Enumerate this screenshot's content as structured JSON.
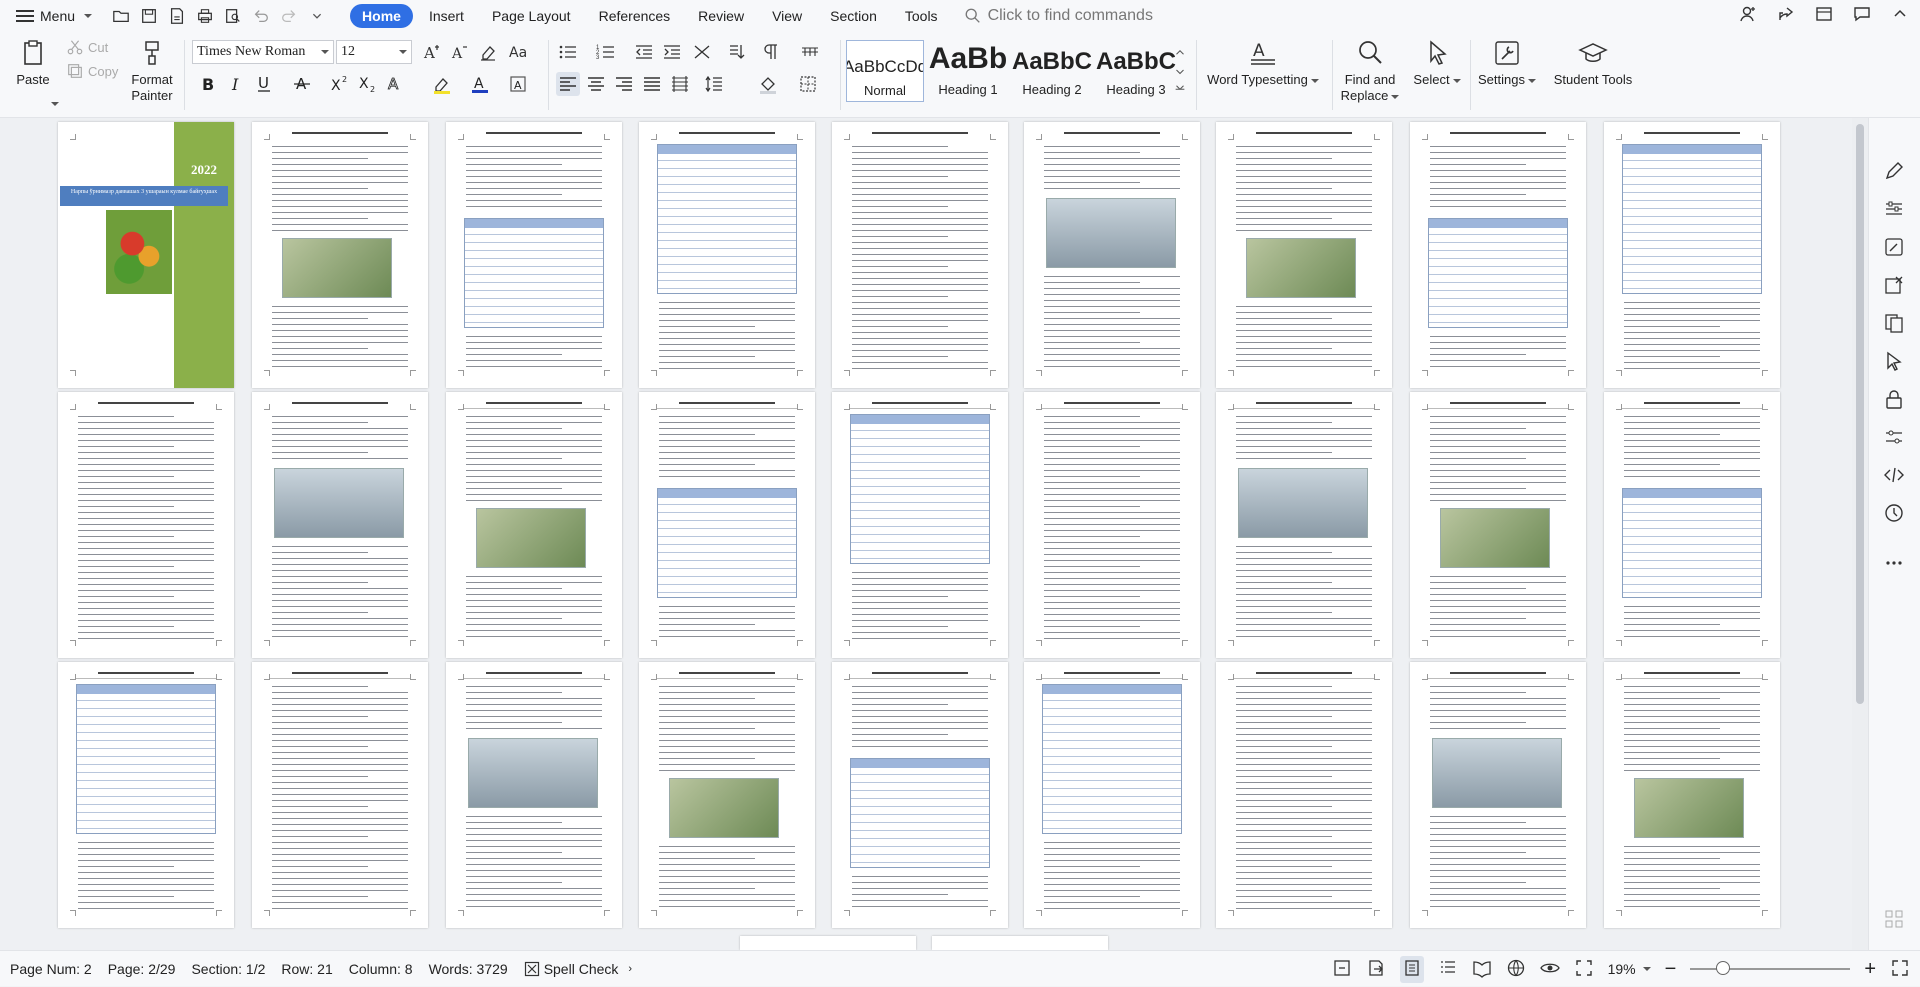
{
  "menubar": {
    "menu_label": "Menu",
    "tabs": [
      {
        "label": "Home",
        "active": true
      },
      {
        "label": "Insert"
      },
      {
        "label": "Page Layout"
      },
      {
        "label": "References"
      },
      {
        "label": "Review"
      },
      {
        "label": "View"
      },
      {
        "label": "Section"
      },
      {
        "label": "Tools"
      }
    ],
    "command_search_placeholder": "Click to find commands"
  },
  "ribbon": {
    "paste_label": "Paste",
    "cut_label": "Cut",
    "copy_label": "Copy",
    "format_painter_label_1": "Format",
    "format_painter_label_2": "Painter",
    "font_name": "Times New Roman",
    "font_size": "12",
    "styles": [
      {
        "preview": "AaBbCcDd",
        "name": "Normal",
        "selected": true
      },
      {
        "preview": "AaBb",
        "name": "Heading 1"
      },
      {
        "preview": "AaBbC",
        "name": "Heading 2"
      },
      {
        "preview": "AaBbC",
        "name": "Heading 3"
      }
    ],
    "word_typesetting_label": "Word Typesetting",
    "find_replace_label_1": "Find and",
    "find_replace_label_2": "Replace",
    "select_label": "Select",
    "settings_label": "Settings",
    "student_tools_label": "Student Tools"
  },
  "document": {
    "cover_year": "2022",
    "cover_title": "Нарпы ўрнимазр даввашах 3 ушараын кулмае байғуҳшах",
    "accent_color": "#2f6fe4",
    "cover_green": "#8bb04a"
  },
  "statusbar": {
    "page_num": "Page Num: 2",
    "page": "Page: 2/29",
    "section": "Section: 1/2",
    "row": "Row: 21",
    "column": "Column: 8",
    "words": "Words: 3729",
    "spell_check": "Spell Check",
    "zoom": "19%"
  }
}
